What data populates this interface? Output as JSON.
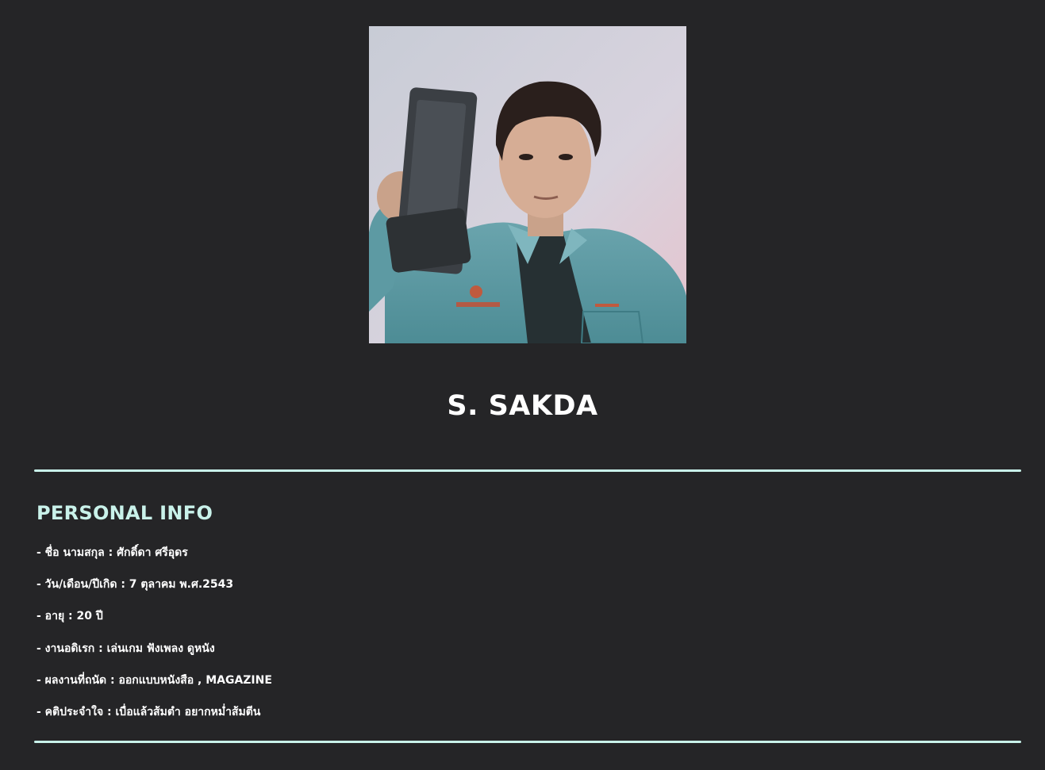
{
  "profile": {
    "name": "S. SAKDA"
  },
  "personal_info": {
    "title": "PERSONAL INFO",
    "items": [
      "- ชื่อ นามสกุล : ศักดิ์ดา ศรีอุดร",
      "- วัน/เดือน/ปีเกิด : 7 ตุลาคม พ.ศ.2543",
      "- อายุ : 20 ปี",
      "- งานอดิเรก : เล่นเกม ฟังเพลง ดูหนัง",
      "- ผลงานที่ถนัด : ออกแบบหนังสือ , MAGAZINE",
      "- คติประจำใจ : เบื่อแล้วส้มตำ อยากหม่ำส้มตีน"
    ]
  },
  "colors": {
    "background": "#252527",
    "accent": "#c9f2ea",
    "text": "#ffffff"
  }
}
